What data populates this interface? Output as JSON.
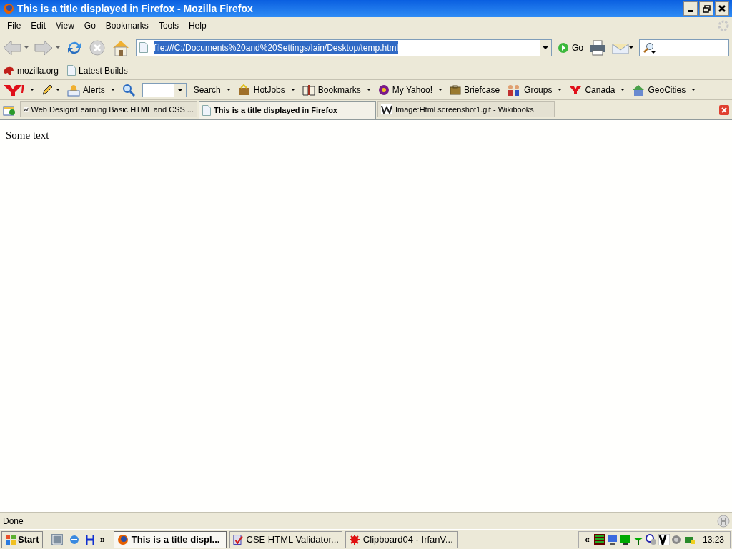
{
  "window": {
    "title": "This is a title displayed in Firefox - Mozilla Firefox"
  },
  "menu": [
    "File",
    "Edit",
    "View",
    "Go",
    "Bookmarks",
    "Tools",
    "Help"
  ],
  "navigation": {
    "url": "file:///C:/Documents%20and%20Settings/Iain/Desktop/temp.html",
    "go_label": "Go"
  },
  "bookmarks_toolbar": [
    "mozilla.org",
    "Latest Builds"
  ],
  "yahoo_toolbar": [
    {
      "kind": "logo",
      "dropdown": true
    },
    {
      "kind": "icon",
      "dropdown": true
    },
    {
      "kind": "button",
      "label": "Alerts",
      "dropdown": true
    },
    {
      "kind": "icon",
      "dropdown": false
    },
    {
      "kind": "field"
    },
    {
      "kind": "button",
      "label": "Search",
      "dropdown": true
    },
    {
      "kind": "button",
      "label": "HotJobs",
      "dropdown": true
    },
    {
      "kind": "button",
      "label": "Bookmarks",
      "dropdown": true
    },
    {
      "kind": "button",
      "label": "My Yahoo!",
      "dropdown": true
    },
    {
      "kind": "button",
      "label": "Briefcase",
      "dropdown": false
    },
    {
      "kind": "button",
      "label": "Groups",
      "dropdown": true
    },
    {
      "kind": "button",
      "label": "Canada",
      "dropdown": true
    },
    {
      "kind": "button",
      "label": "GeoCities",
      "dropdown": true
    }
  ],
  "tabs": [
    {
      "label": "Web Design:Learning Basic HTML and CSS ...",
      "selected": false
    },
    {
      "label": "This is a title displayed in Firefox",
      "selected": true
    },
    {
      "label": "Image:Html screenshot1.gif - Wikibooks",
      "selected": false
    }
  ],
  "content": {
    "text": "Some text"
  },
  "status_bar": {
    "text": "Done"
  },
  "taskbar": {
    "start": "Start",
    "quick_launch_more": "»",
    "tasks": [
      {
        "label": "This is a title displ...",
        "selected": true
      },
      {
        "label": "CSE HTML Validator...",
        "selected": false
      },
      {
        "label": "Clipboard04 - IrfanV...",
        "selected": false
      }
    ],
    "tray_expand": "«",
    "clock": "13:23"
  }
}
